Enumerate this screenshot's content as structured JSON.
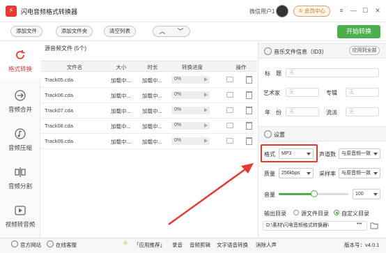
{
  "app": {
    "title": "闪电音频格式转换器",
    "user": "微信用户1",
    "vip": "会员中心",
    "window_controls": [
      "≡",
      "—",
      "☐",
      "✕"
    ]
  },
  "toolbar": {
    "add_file": "添加文件",
    "add_folder": "添加文件夹",
    "clear_list": "清空列表",
    "up": "︿",
    "down": "﹀",
    "start": "开始转换"
  },
  "sidebar": {
    "items": [
      {
        "label": "格式转换",
        "icon": "refresh-icon",
        "active": true
      },
      {
        "label": "音频合并",
        "icon": "merge-icon",
        "active": false
      },
      {
        "label": "音频压缩",
        "icon": "compress-icon",
        "active": false
      },
      {
        "label": "音频分割",
        "icon": "split-icon",
        "active": false
      },
      {
        "label": "视频转音频",
        "icon": "video-icon",
        "active": false
      }
    ]
  },
  "list": {
    "title": "源音频文件 (5个)",
    "columns": [
      "文件名",
      "大小",
      "时长",
      "转换进度",
      "操作"
    ],
    "rows": [
      {
        "name": "Track05.cda",
        "size": "加载中...",
        "duration": "加载中...",
        "progress": "0%"
      },
      {
        "name": "Track06.cda",
        "size": "加载中...",
        "duration": "加载中...",
        "progress": "0%"
      },
      {
        "name": "Track07.cda",
        "size": "加载中...",
        "duration": "加载中...",
        "progress": "0%"
      },
      {
        "name": "Track08.cda",
        "size": "加载中...",
        "duration": "加载中...",
        "progress": "0%"
      },
      {
        "name": "Track09.cda",
        "size": "加载中...",
        "duration": "加载中...",
        "progress": "0%"
      }
    ]
  },
  "id3": {
    "title": "音乐文件信息（ID3）",
    "apply_all": "应用到全部",
    "title_label": "标　题",
    "title_placeholder": "无",
    "artist_label": "艺术家",
    "artist_placeholder": "无",
    "album_label": "专辑",
    "album_placeholder": "无",
    "year_label": "年　份",
    "year_placeholder": "无",
    "genre_label": "流派",
    "genre_placeholder": "无"
  },
  "settings": {
    "title": "设置",
    "format_label": "格式",
    "format_value": "MP3",
    "channel_label": "声道数",
    "channel_value": "与原音频一致",
    "quality_label": "质量",
    "quality_value": "256kbps",
    "sample_label": "采样率",
    "sample_value": "与原音频一致",
    "volume_label": "音量",
    "volume_value": "100",
    "volume_level": 0.5,
    "output_label": "输出目录",
    "output_source": "源文件目录",
    "output_custom": "自定义目录",
    "output_path": "D:\\素材\\闪电音频格式转换器\\",
    "browse": "•••"
  },
  "status": {
    "website": "官方网站",
    "support": "在线客服",
    "recommend": "「应用推荐」",
    "links": [
      "录音",
      "音频剪辑",
      "文字语音转换",
      "消除人声"
    ],
    "version": "版本号：v4.0.1"
  },
  "colors": {
    "accent": "#e8392f",
    "green": "#4cae4c"
  }
}
